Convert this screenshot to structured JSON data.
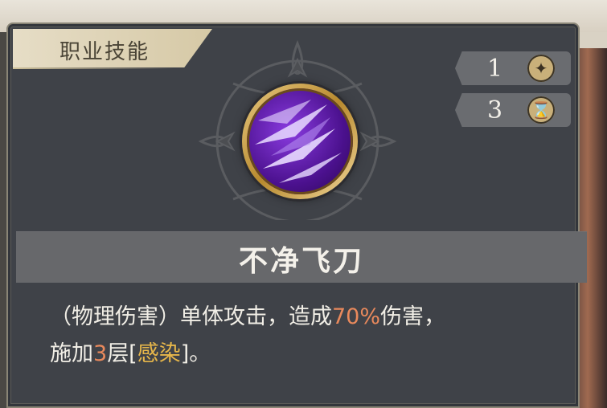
{
  "panel": {
    "title": "职业技能",
    "skill_name": "不净飞刀",
    "cost_badges": [
      {
        "value": "1",
        "icon": "sparkle-icon"
      },
      {
        "value": "3",
        "icon": "hourglass-icon"
      }
    ],
    "description": {
      "part1": "（物理伤害）单体攻击，造成",
      "damage": "70%",
      "part2": "伤害，",
      "part3": "施加",
      "stacks": "3",
      "part4": "层[",
      "effect": "感染",
      "part5": "]。"
    }
  },
  "colors": {
    "panel_bg": "#3f4248",
    "name_band": "#67686b",
    "highlight_orange": "#e9895c",
    "highlight_gold": "#e6b64a"
  }
}
